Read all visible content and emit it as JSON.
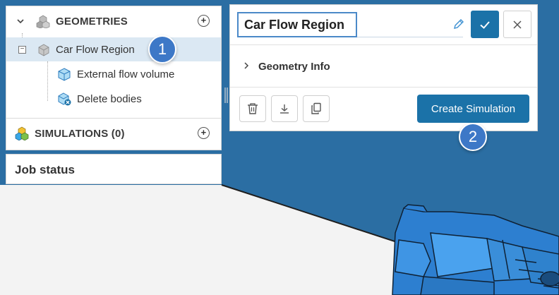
{
  "tree": {
    "geometries_label": "GEOMETRIES",
    "geometry_item": "Car Flow Region",
    "operations": [
      {
        "label": "External flow volume"
      },
      {
        "label": "Delete bodies"
      }
    ],
    "simulations_label": "SIMULATIONS (0)",
    "add_symbol": "+",
    "collapse_symbol": "−"
  },
  "job_status": {
    "title": "Job status"
  },
  "dialog": {
    "name_value": "Car Flow Region",
    "geometry_info_label": "Geometry Info",
    "create_simulation_label": "Create Simulation"
  },
  "badges": {
    "one": "1",
    "two": "2"
  },
  "colors": {
    "primary": "#1b72a8",
    "badge": "#3d78c7",
    "viewport_blue": "#2b6ea3",
    "selected_row": "#dbe8f3"
  },
  "icons": {
    "geometries": "cubes-gray-icon",
    "geometry_item": "cube-gray-icon",
    "external_flow": "box-blue-icon",
    "delete_bodies": "box-delete-icon",
    "simulations": "cubes-color-icon",
    "edit": "pencil-icon",
    "confirm": "check-icon",
    "cancel": "close-icon",
    "delete": "trash-icon",
    "download": "download-icon",
    "copy": "copy-icon"
  }
}
